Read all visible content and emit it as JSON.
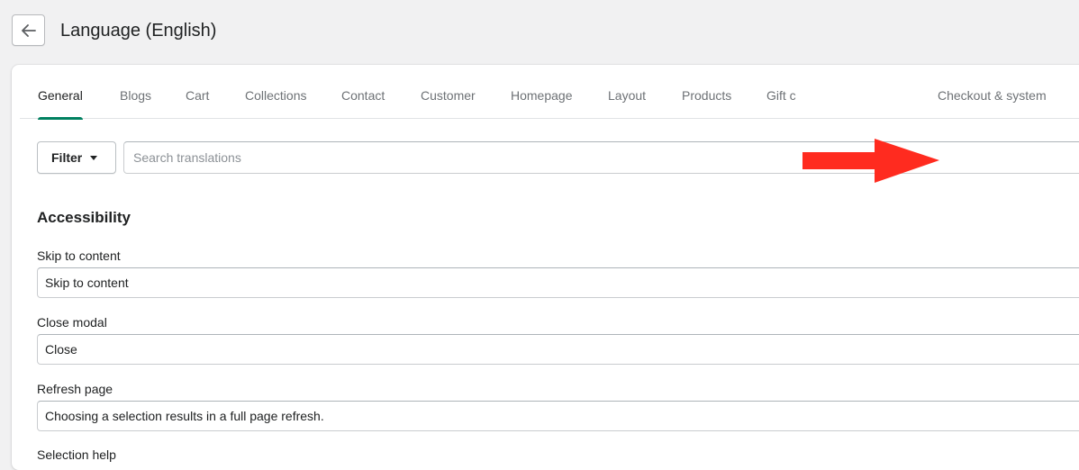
{
  "header": {
    "title": "Language (English)",
    "back_icon": "arrow-left-icon"
  },
  "tabs": [
    {
      "label": "General",
      "active": true
    },
    {
      "label": "Blogs"
    },
    {
      "label": "Cart"
    },
    {
      "label": "Collections"
    },
    {
      "label": "Contact"
    },
    {
      "label": "Customer"
    },
    {
      "label": "Homepage"
    },
    {
      "label": "Layout"
    },
    {
      "label": "Products"
    },
    {
      "label": "Gift c"
    },
    {
      "label": "Checkout & system"
    }
  ],
  "toolbar": {
    "filter_label": "Filter",
    "search_placeholder": "Search translations"
  },
  "section": {
    "title": "Accessibility",
    "fields": [
      {
        "label": "Skip to content",
        "value": "Skip to content"
      },
      {
        "label": "Close modal",
        "value": "Close"
      },
      {
        "label": "Refresh page",
        "value": "Choosing a selection results in a full page refresh."
      },
      {
        "label": "Selection help",
        "value": ""
      }
    ]
  },
  "colors": {
    "accent": "#008060",
    "annotation_arrow": "#ff2b1f"
  }
}
